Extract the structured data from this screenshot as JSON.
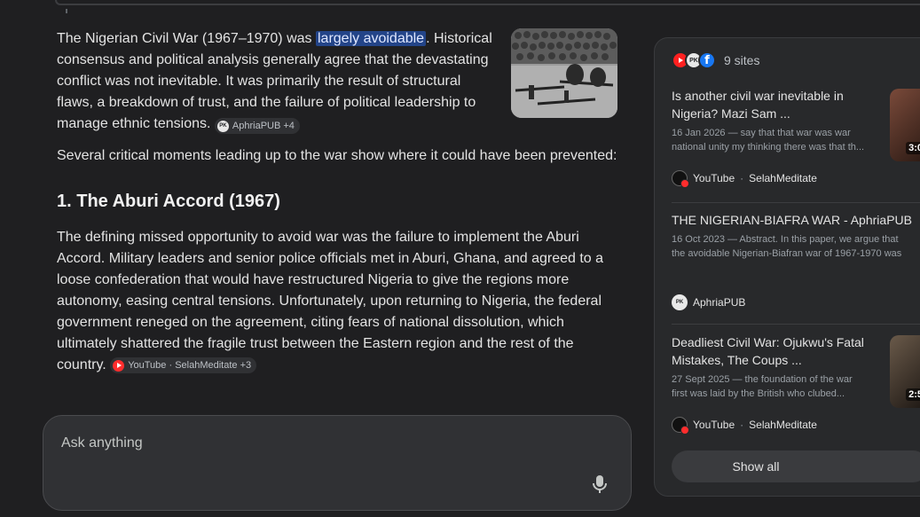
{
  "answer": {
    "para1_a": "The Nigerian Civil War (1967–1970) was ",
    "para1_highlight": "largely avoidable",
    "para1_b": ". Historical consensus and political analysis generally agree that the devastating conflict was not inevitable. It was primarily the result of structural flaws, a breakdown of trust, and the failure of political leadership to manage ethnic tensions.",
    "para1_chip": "AphriaPUB +4",
    "para2": "Several critical moments leading up to the war show where it could have been prevented:",
    "heading1": "1. The Aburi Accord (1967)",
    "para3": "The defining missed opportunity to avoid war was the failure to implement the Aburi Accord. Military leaders and senior police officials met in Aburi, Ghana, and agreed to a loose confederation that would have restructured Nigeria to give the regions more autonomy, easing central tensions. Unfortunately, upon returning to Nigeria, the federal government reneged on the agreement, citing fears of national dissolution, which ultimately shattered the fragile trust between the Eastern region and the rest of the country.",
    "para3_chip": "YouTube · SelahMeditate +3"
  },
  "ask": {
    "placeholder": "Ask anything"
  },
  "sources": {
    "count_label": "9 sites",
    "items": [
      {
        "title": "Is another civil war inevitable in Nigeria? Mazi Sam ...",
        "snippet1": "16 Jan 2026 — say that that war was war",
        "snippet2": "national unity my thinking there was that th...",
        "site": "YouTube",
        "author": "SelahMeditate",
        "duration": "3:0"
      },
      {
        "title": "THE NIGERIAN-BIAFRA WAR - AphriaPUB",
        "snippet1": "16 Oct 2023 — Abstract. In this paper, we argue that",
        "snippet2": "the avoidable Nigerian-Biafran war of 1967-1970 was",
        "site": "AphriaPUB"
      },
      {
        "title": "Deadliest Civil War: Ojukwu's Fatal Mistakes, The Coups ...",
        "snippet1": "27 Sept 2025 — the foundation of the war",
        "snippet2": "first was laid by the British who clubed...",
        "site": "YouTube",
        "author": "SelahMeditate",
        "duration": "2:5"
      }
    ],
    "show_all": "Show all",
    "dot": "·",
    "pk_mark": "PK"
  },
  "colors": {
    "highlight": "#234488",
    "panel": "#28292b",
    "background": "#1f1f21"
  }
}
